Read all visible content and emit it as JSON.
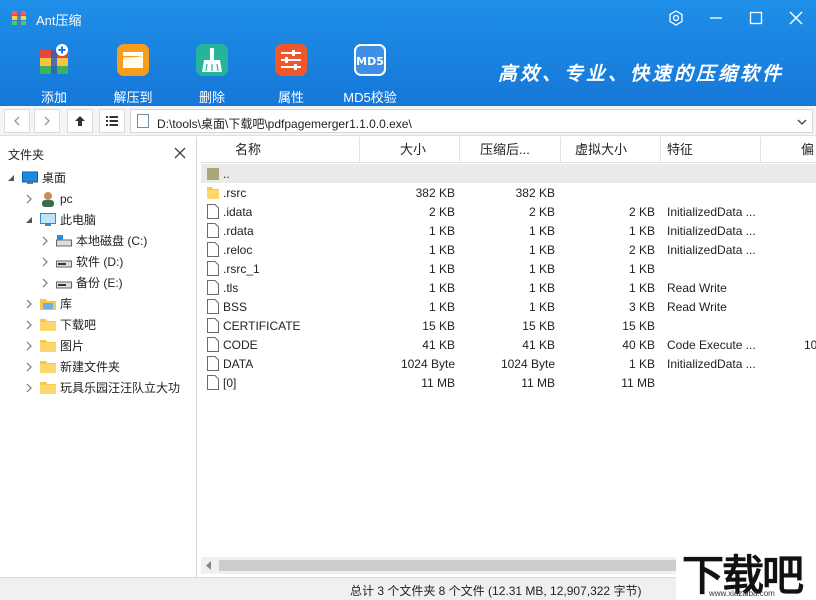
{
  "window": {
    "title": "Ant压缩",
    "slogan": "高效、专业、快速的压缩软件"
  },
  "toolbar": {
    "items": [
      {
        "label": "添加",
        "icon": "add-archive-icon"
      },
      {
        "label": "解压到",
        "icon": "extract-folder-icon"
      },
      {
        "label": "删除",
        "icon": "broom-icon"
      },
      {
        "label": "属性",
        "icon": "sliders-icon"
      },
      {
        "label": "MD5校验",
        "icon": "md5-icon",
        "badge": "MD5"
      }
    ]
  },
  "address": {
    "path": "D:\\tools\\桌面\\下载吧\\pdfpagemerger1.1.0.0.exe\\"
  },
  "tree": {
    "title": "文件夹",
    "nodes": [
      {
        "label": "桌面",
        "icon": "desktop-icon"
      },
      {
        "label": "pc",
        "icon": "user-icon"
      },
      {
        "label": "此电脑",
        "icon": "computer-icon"
      },
      {
        "label": "本地磁盘 (C:)",
        "icon": "drive-icon"
      },
      {
        "label": "软件 (D:)",
        "icon": "drive-icon"
      },
      {
        "label": "备份 (E:)",
        "icon": "drive-icon"
      },
      {
        "label": "库",
        "icon": "library-icon"
      },
      {
        "label": "下载吧",
        "icon": "folder-icon"
      },
      {
        "label": "图片",
        "icon": "folder-icon"
      },
      {
        "label": "新建文件夹",
        "icon": "folder-icon"
      },
      {
        "label": "玩具乐园汪汪队立大功",
        "icon": "folder-icon"
      }
    ]
  },
  "filelist": {
    "columns": [
      "名称",
      "大小",
      "压缩后...",
      "虚拟大小",
      "特征",
      "偏"
    ],
    "parent_label": "..",
    "rows": [
      {
        "name": ".rsrc",
        "size": "382 KB",
        "packed": "382 KB",
        "virtual": "",
        "feature": "",
        "offset": "",
        "type": "folder"
      },
      {
        "name": ".idata",
        "size": "2 KB",
        "packed": "2 KB",
        "virtual": "2 KB",
        "feature": "InitializedData ...",
        "offset": "",
        "type": "file"
      },
      {
        "name": ".rdata",
        "size": "1 KB",
        "packed": "1 KB",
        "virtual": "1 KB",
        "feature": "InitializedData ...",
        "offset": "",
        "type": "file"
      },
      {
        "name": ".reloc",
        "size": "1 KB",
        "packed": "1 KB",
        "virtual": "2 KB",
        "feature": "InitializedData ...",
        "offset": "",
        "type": "file"
      },
      {
        "name": ".rsrc_1",
        "size": "1 KB",
        "packed": "1 KB",
        "virtual": "1 KB",
        "feature": "",
        "offset": "",
        "type": "file"
      },
      {
        "name": ".tls",
        "size": "1 KB",
        "packed": "1 KB",
        "virtual": "1 KB",
        "feature": "Read Write",
        "offset": "",
        "type": "file"
      },
      {
        "name": "BSS",
        "size": "1 KB",
        "packed": "1 KB",
        "virtual": "3 KB",
        "feature": "Read Write",
        "offset": "",
        "type": "file"
      },
      {
        "name": "CERTIFICATE",
        "size": "15 KB",
        "packed": "15 KB",
        "virtual": "15 KB",
        "feature": "",
        "offset": "",
        "type": "file"
      },
      {
        "name": "CODE",
        "size": "41 KB",
        "packed": "41 KB",
        "virtual": "40 KB",
        "feature": "Code Execute ...",
        "offset": "10",
        "type": "file"
      },
      {
        "name": "DATA",
        "size": "1024 Byte",
        "packed": "1024 Byte",
        "virtual": "1 KB",
        "feature": "InitializedData ...",
        "offset": "",
        "type": "file"
      },
      {
        "name": "[0]",
        "size": "11 MB",
        "packed": "11 MB",
        "virtual": "11 MB",
        "feature": "",
        "offset": "",
        "type": "file"
      }
    ]
  },
  "status": {
    "text": "总计 3 个文件夹 8 个文件 (12.31 MB,  12,907,322 字节)"
  },
  "watermark": {
    "main": "下载吧",
    "url": "www.xiazaiba.com"
  },
  "colors": {
    "header_blue": "#1677d8",
    "folder_yellow": "#f7c948"
  }
}
